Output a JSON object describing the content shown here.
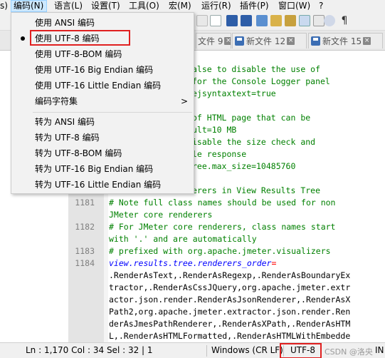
{
  "menubar": {
    "items": [
      "s)",
      "编码(N)",
      "语言(L)",
      "设置(T)",
      "工具(O)",
      "宏(M)",
      "运行(R)",
      "插件(P)",
      "窗口(W)",
      "?"
    ]
  },
  "tabs": [
    {
      "label": "文件 9"
    },
    {
      "label": "新文件 12"
    },
    {
      "label": "新文件 15"
    }
  ],
  "encoding_menu": {
    "items": [
      {
        "label": "使用 ANSI 编码",
        "checked": false
      },
      {
        "label": "使用 UTF-8 编码",
        "checked": true
      },
      {
        "label": "使用 UTF-8-BOM 编码",
        "checked": false
      },
      {
        "label": "使用 UTF-16 Big Endian 编码",
        "checked": false
      },
      {
        "label": "使用 UTF-16 Little Endian 编码",
        "checked": false
      },
      {
        "label": "编码字符集",
        "submenu": true
      },
      {
        "label": "转为 ANSI 编码"
      },
      {
        "label": "转为 UTF-8 编码"
      },
      {
        "label": "转为 UTF-8-BOM 编码"
      },
      {
        "label": "转为 UTF-16 Big Endian 编码"
      },
      {
        "label": "转为 UTF-16 Little Endian 编码"
      }
    ],
    "submenu_arrow": ">"
  },
  "editor": {
    "line_numbers": [
      "1181",
      "1182",
      "1183",
      "1184"
    ],
    "lines": [
      "alse to disable the use of",
      "for the Console Logger panel",
      "ejsyntaxtext=true",
      "",
      "of HTML page that can be",
      "ult=10 MB",
      "isable the size check and",
      "le response",
      "ree.max_size=10485760",
      "",
      "erers in View Results Tree",
      "# Note full class names should be used for non",
      "JMeter core renderers",
      "# For JMeter core renderers, class names start",
      "with '.' and are automatically",
      "# prefixed with org.apache.jmeter.visualizers",
      "view.results.tree.renderers_order",
      ".RenderAsText,.RenderAsRegexp,.RenderAsBoundaryEx",
      "tractor,.RenderAsCssJQuery,org.apache.jmeter.extr",
      "actor.json.render.RenderAsJsonRenderer,.RenderAsX",
      "Path2,org.apache.jmeter.extractor.json.render.Ren",
      "derAsJmesPathRenderer,.RenderAsXPath,.RenderAsHTM",
      "L,.RenderAsHTMLFormatted,.RenderAsHTMLWithEmbedde"
    ],
    "key_eq": "="
  },
  "statusbar": {
    "position": "Ln : 1,170    Col : 34    Sel : 32 | 1",
    "eol": "Windows (CR LF)",
    "encoding": "UTF-8",
    "watermark": "CSDN @洛央",
    "mode": "IN"
  },
  "colors": {
    "highlight_red": "#e02020",
    "comment": "#008000",
    "key": "#0000ff"
  }
}
